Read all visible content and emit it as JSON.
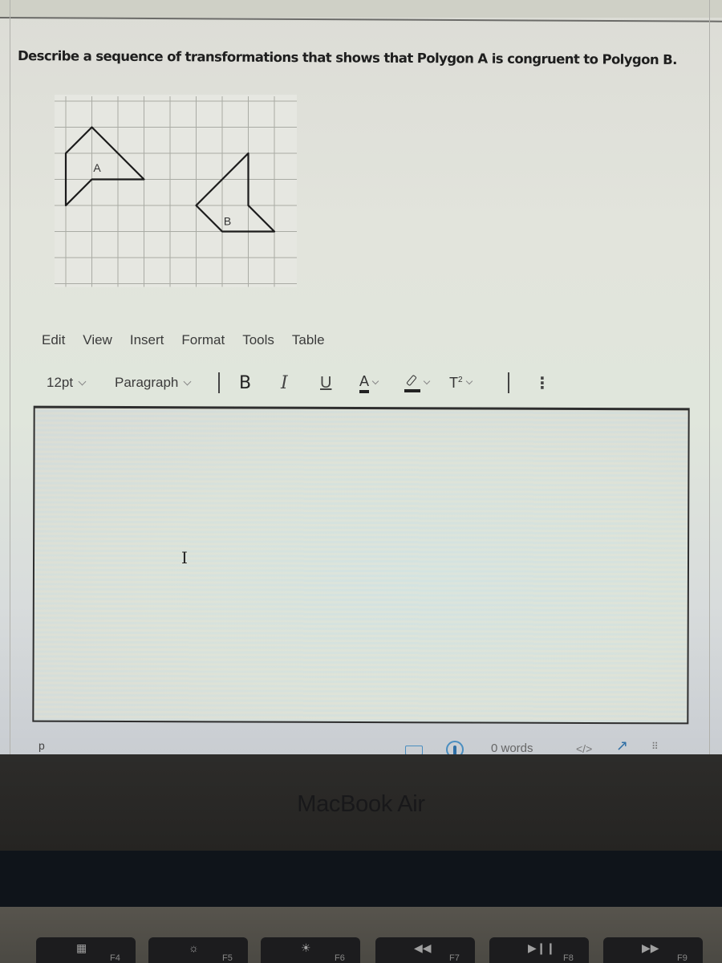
{
  "question": {
    "prompt": "Describe a sequence of transformations that shows that Polygon A is congruent to Polygon B."
  },
  "diagram": {
    "polygon_a_label": "A",
    "polygon_b_label": "B",
    "grid_columns": 9,
    "grid_rows": 7,
    "polygon_a_vertices": [
      [
        0,
        2
      ],
      [
        1,
        1
      ],
      [
        3,
        3
      ],
      [
        1,
        3
      ],
      [
        0,
        4
      ]
    ],
    "polygon_b_vertices": [
      [
        7,
        2
      ],
      [
        7,
        4
      ],
      [
        8,
        5
      ],
      [
        6,
        5
      ],
      [
        5,
        4
      ]
    ]
  },
  "editor": {
    "menu": [
      "Edit",
      "View",
      "Insert",
      "Format",
      "Tools",
      "Table"
    ],
    "toolbar": {
      "font_size": "12pt",
      "block_format": "Paragraph",
      "bold_label": "B",
      "italic_label": "I",
      "underline_label": "U",
      "text_color_label": "A",
      "superscript_label": "T",
      "superscript_exp": "2",
      "more_label": "⋮"
    },
    "content": "",
    "cursor_glyph": "I"
  },
  "statusbar": {
    "path": "p",
    "word_count": "0 words",
    "html_toggle": "</>",
    "fullscreen_glyph": "↗",
    "resize_glyph": "⠿",
    "accent_color": "#2f6fa5"
  },
  "device": {
    "label": "MacBook Air",
    "keys": [
      {
        "glyph": "▦",
        "fn": "F4"
      },
      {
        "glyph": "☼",
        "fn": "F5"
      },
      {
        "glyph": "☀",
        "fn": "F6"
      },
      {
        "glyph": "◀◀",
        "fn": "F7"
      },
      {
        "glyph": "▶❙❙",
        "fn": "F8"
      },
      {
        "glyph": "▶▶",
        "fn": "F9"
      }
    ]
  }
}
